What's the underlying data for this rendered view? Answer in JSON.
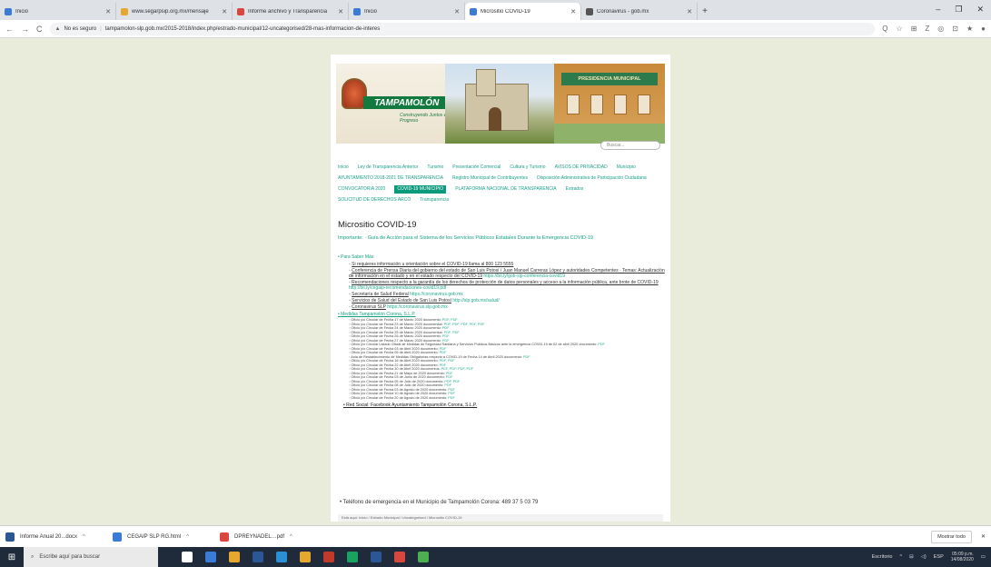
{
  "browser": {
    "tabs": [
      {
        "label": "Inicio",
        "color": "#3a7bd5"
      },
      {
        "label": "www.segarpsip.org.mx/mensaje",
        "color": "#e7a72f"
      },
      {
        "label": "Informe anchivo y Transparencia",
        "color": "#d9463e"
      },
      {
        "label": "Inicio",
        "color": "#3a7bd5"
      },
      {
        "label": "Micrositio COVID-19",
        "color": "#3a7bd5"
      },
      {
        "label": "Coronavirus - gob.mx",
        "color": "#555555"
      }
    ],
    "active_tab_index": 4,
    "new_tab": "+",
    "window_controls": [
      "–",
      "❐",
      "✕"
    ],
    "security_label": "No es seguro",
    "url": "tampamolon-slp.gob.mx/2015-2018/index.php/estrado-municipal/12-uncategorised/28-mas-informacion-de-interes",
    "ext_icons": [
      "Q",
      "☆",
      "⊞",
      "Z",
      "◎",
      "⊡",
      "★",
      "●"
    ]
  },
  "site": {
    "logo_text": "TAMPAMOLÓN",
    "logo_slogan": "Construyendo Juntos el Progreso",
    "building_sign": "PRESIDENCIA MUNICIPAL",
    "search_placeholder": "Buscar...",
    "menu": [
      "Inicio",
      "Ley de Transparencia Anterior",
      "Turismo",
      "Presentación Comercial",
      "Cultura y Turismo",
      "AVISOS DE PRIVACIDAD",
      "Municipio",
      "AYUNTAMIENTO 2018-2021 DE TRANSPARENCIA",
      "Registro Municipal de Contribuyentes",
      "Disposición Administrativa de Participación Ciudadana",
      "CONVOCATORIA 2020",
      "COVID-19 MUNICIPIO",
      "PLATAFORMA NACIONAL DE TRANSPARENCIA",
      "Estrados",
      "SOLICITUD DE DERECHOS ARCO",
      "Transparencia"
    ],
    "menu_active_index": 11,
    "page_title": "Micrositio COVID-19",
    "important": "Importante: · Guía de Acción para el Sistema de los Servicios Públicos Estatales Durante la Emergencia COVID-19",
    "section1_title": "Para Saber Más:",
    "section1_items": [
      {
        "text": "Si requieres información u orientación sobre el COVID-19 llama al 800 123 5555",
        "url": ""
      },
      {
        "text": "Conferencia de Prensa Diaria del gobierno del estado de San Luis Potosí / Juan Manuel Carreras López y autoridades Competentes · Temas: Actualización de información en el estado y en el estado respecto del COVID-19",
        "url": "https://bit.ly/gob-slp-conferencia-covid19"
      },
      {
        "text": "Recomendaciones respecto a la garantía de los derechos de protección de datos personales y acceso a la información pública, ante brote de COVID-19",
        "url": "http://bit.ly/cegaip-recomendaciones-covid19.pdf"
      },
      {
        "text": "Secretaría de Salud Federal",
        "url": "https://coronavirus.gob.mx"
      },
      {
        "text": "Servicios de Salud del Estado de San Luis Potosí",
        "url": "http://slp.gob.mx/salud/"
      },
      {
        "text": "Coronavirus SLP",
        "url": "https://coronavirus.slp.gob.mx"
      }
    ],
    "section2_title": "Medidas Tampamolón Corona, S.L.P.",
    "section2_items": [
      {
        "text": "Oficio y/o Circular de Fecha 17 de Marzo 2020 documento:",
        "links": "PDF, PDF"
      },
      {
        "text": "Oficio y/o Circular de Fecha 23 de Marzo 2020 documentos:",
        "links": "PDF, PDF, PDF, PDF, PDF"
      },
      {
        "text": "Oficio y/o Circular de Fecha 24 de Marzo 2020 documento:",
        "links": "PDF"
      },
      {
        "text": "Oficio y/o Circular de Fecha 25 de Marzo 2020 documentos:",
        "links": "PDF, PDF"
      },
      {
        "text": "Oficio y/o Circular de Fecha 26 de Marzo 2020 documento:",
        "links": "PDF"
      },
      {
        "text": "Oficio y/o Circular de Fecha 27 de Marzo 2020 documento:",
        "links": "PDF"
      },
      {
        "text": "Oficio y/o Circular Listado Oficial de Medidas de Seguridad Sanitaria y Servicios Públicos Básicos ante la emergencia COVID-19 de 02 de abril 2020 documento:",
        "links": "PDF"
      },
      {
        "text": "Oficio y/o Circular de Fecha 03 de Abril 2020 documento:",
        "links": "PDF"
      },
      {
        "text": "Oficio y/o Circular de Fecha 06 de Abril 2020 documento:",
        "links": "PDF"
      },
      {
        "text": "Acta de Restablecimiento de Medidas Obligatorias respecto a COVID-19 de Fecha 14 de Abril 2020 documento:",
        "links": "PDF"
      },
      {
        "text": "Oficio y/o Circular de Fecha 16 de Abril 2020 documento:",
        "links": "PDF, PDF"
      },
      {
        "text": "Oficio y/o Circular de Fecha 22 de Abril 2020 documento:",
        "links": "PDF"
      },
      {
        "text": "Oficio y/o Circular de Fecha 30 de Abril 2020 documentos:",
        "links": "PDF, PDF, PDF, PDF"
      },
      {
        "text": "Oficio y/o Circular de Fecha 21 de Mayo de 2020 documento:",
        "links": "PDF"
      },
      {
        "text": "Oficio y/o Circular de Fecha 03 de Junio de 2020 documento:",
        "links": "PDF"
      },
      {
        "text": "Oficio y/o Circular de Fecha 05 de Julio de 2020 documento:",
        "links": "PDF, PDF"
      },
      {
        "text": "Oficio y/o Circular de Fecha 08 de Julio de 2020 documento:",
        "links": "PDF"
      },
      {
        "text": "Oficio y/o Circular de Fecha 03 de Agosto de 2020 documento:",
        "links": "PDF"
      },
      {
        "text": "Oficio y/o Circular de Fecha 10 de Agosto de 2020 documento:",
        "links": "PDF"
      },
      {
        "text": "Oficio y/o Circular de Fecha 20 de Agosto de 2020 documento:",
        "links": "PDF"
      }
    ],
    "more_link": "Red Social: Facebook Ayuntamiento Tampamolón Corona, S.L.P.",
    "phone": "Teléfono de emergencia en el Municipio de Tampamolón Corona: 489 37 5 03 79",
    "breadcrumb": "Está aquí: Inicio / Estrado Municipal / Uncategorised / Micrositio COVID-19"
  },
  "downloads": {
    "items": [
      {
        "label": "Informe Anual 20...docx",
        "color": "#2b5797"
      },
      {
        "label": "CEGAIP SLP RG.html",
        "color": "#3a7bd5"
      },
      {
        "label": "DPREYNADEL…pdf",
        "color": "#d9463e"
      }
    ],
    "show_all": "Mostrar todo"
  },
  "taskbar": {
    "search_placeholder": "Escribe aquí para buscar",
    "app_colors": [
      "#ffffff",
      "#3a7bd5",
      "#e7a72f",
      "#2b5797",
      "#2b8fd6",
      "#e7a72f",
      "#c0392b",
      "#1aa260",
      "#2b5797",
      "#d9463e",
      "#4caf50"
    ],
    "tray_label": "Escritorio",
    "lang": "ESP",
    "time": "05:09 p.m.",
    "date": "14/08/2020"
  }
}
